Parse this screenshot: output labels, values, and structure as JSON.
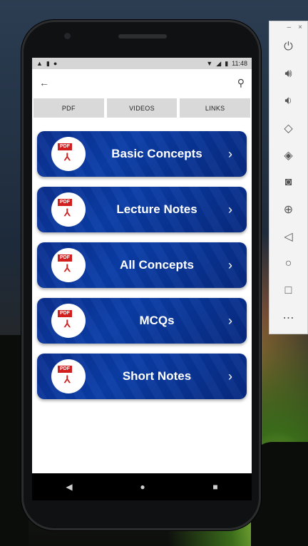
{
  "statusbar": {
    "time": "11:48",
    "left_icons": [
      "warning-icon",
      "lock-icon",
      "circle-icon"
    ],
    "right_icons": [
      "wifi-icon",
      "signal-icon",
      "battery-icon"
    ]
  },
  "appbar": {
    "back_icon": "arrow-left-icon",
    "search_icon": "search-icon"
  },
  "tabs": [
    {
      "label": "PDF"
    },
    {
      "label": "VIDEOS"
    },
    {
      "label": "LINKS"
    }
  ],
  "cards": [
    {
      "label": "Basic Concepts",
      "icon_tag": "PDF"
    },
    {
      "label": "Lecture Notes",
      "icon_tag": "PDF"
    },
    {
      "label": "All Concepts",
      "icon_tag": "PDF"
    },
    {
      "label": "MCQs",
      "icon_tag": "PDF"
    },
    {
      "label": "Short Notes",
      "icon_tag": "PDF"
    }
  ],
  "colors": {
    "card_blue": "#0a3da7",
    "pdf_red": "#d11f1f",
    "tab_gray": "#d9d9d9"
  },
  "navbar": [
    "back-triangle-icon",
    "home-circle-icon",
    "recents-square-icon"
  ],
  "emulator_toolbar": [
    "power-icon",
    "volume-up-icon",
    "volume-down-icon",
    "rotate-left-icon",
    "rotate-right-icon",
    "camera-icon",
    "zoom-icon",
    "back-icon",
    "home-icon",
    "overview-icon",
    "more-icon"
  ]
}
